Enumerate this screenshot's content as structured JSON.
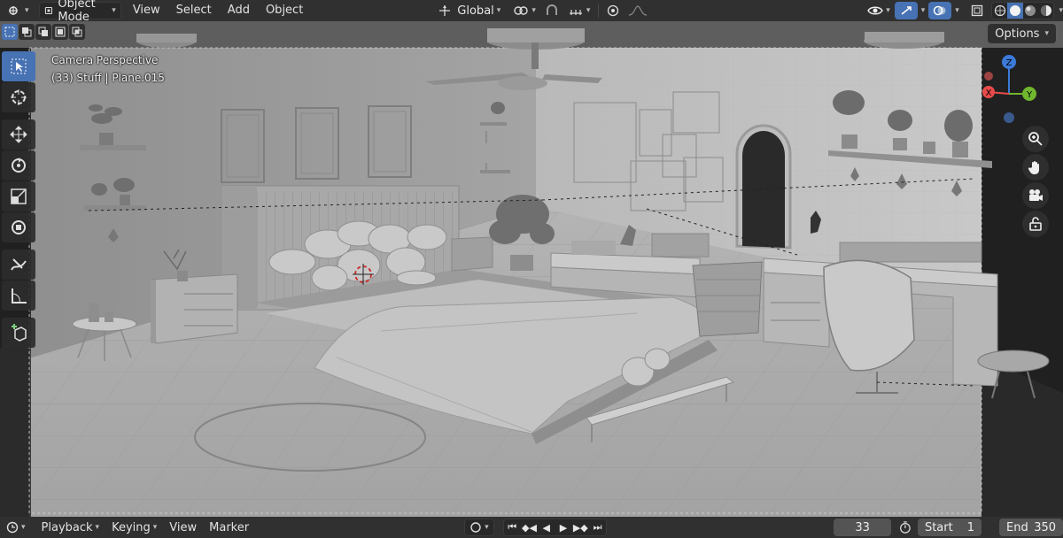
{
  "header": {
    "mode": "Object Mode",
    "menu": [
      "View",
      "Select",
      "Add",
      "Object"
    ],
    "transform_orientation": "Global",
    "icons": [
      "editor-type-icon",
      "object-mode-icon",
      "pivot-icon",
      "snap-icon",
      "proportional-icon",
      "visibility-icon",
      "gizmo-icon",
      "overlay-icon",
      "xray-icon",
      "wireframe-shading-icon",
      "solid-shading-icon",
      "material-shading-icon",
      "rendered-shading-icon"
    ]
  },
  "viewport": {
    "camera_label": "Camera Perspective",
    "object_label": "(33) Stuff | Plane.015",
    "options_label": "Options",
    "axes": {
      "x": "X",
      "y": "Y",
      "z": "Z"
    },
    "colors": {
      "bg": "#a6a6a6",
      "accent": "#4772b3",
      "x_axis": "#e94b4b",
      "y_axis": "#70b62f",
      "z_axis": "#3b7ad9"
    }
  },
  "toolbar": {
    "tools": [
      "select-box-tool",
      "cursor-tool",
      "move-tool",
      "rotate-tool",
      "scale-tool",
      "transform-tool",
      "annotate-tool",
      "measure-tool",
      "add-cube-tool"
    ]
  },
  "timeline": {
    "menu": [
      "Playback",
      "Keying",
      "View",
      "Marker"
    ],
    "current_frame": "33",
    "start_label": "Start",
    "start_value": "1",
    "end_label": "End",
    "end_value": "350"
  }
}
